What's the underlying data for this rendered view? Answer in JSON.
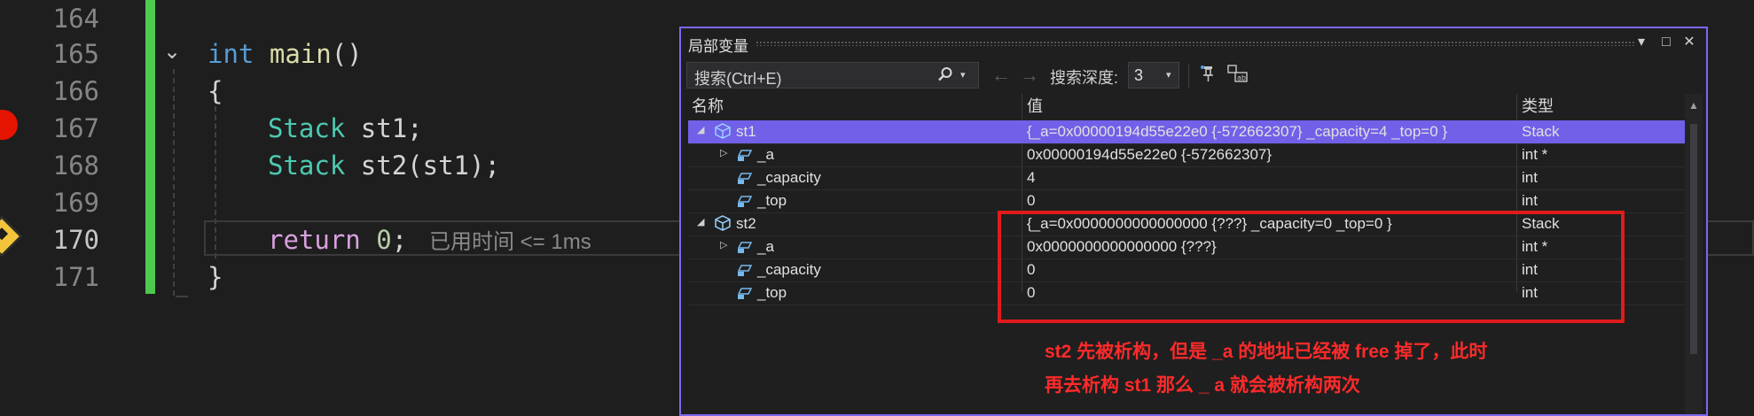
{
  "editor": {
    "lines": [
      {
        "number": "164"
      },
      {
        "number": "165",
        "tokens": {
          "keyword": "int",
          "name": "main",
          "rest": "()"
        }
      },
      {
        "number": "166",
        "text": "{"
      },
      {
        "number": "167",
        "tokens": {
          "type": "Stack",
          "rest": " st1;"
        }
      },
      {
        "number": "168",
        "tokens": {
          "type": "Stack",
          "name": "st2",
          "rest": "(st1);"
        }
      },
      {
        "number": "169"
      },
      {
        "number": "170",
        "tokens": {
          "keyword": "return",
          "value": "0",
          "rest": ";"
        }
      },
      {
        "number": "171",
        "text": "}"
      }
    ],
    "elapsed_hint": "已用时间 <= 1ms",
    "fold_icon": "chevron-down-icon",
    "colors": {
      "change_bar": "#4ec94e",
      "breakpoint": "#e51400",
      "current_statement": "#f3c53a"
    }
  },
  "locals_window": {
    "title": "局部变量",
    "title_buttons": {
      "dropdown": "▾",
      "maximize": "□",
      "close": "✕"
    },
    "search": {
      "placeholder": "搜索(Ctrl+E)",
      "icon": "search-icon",
      "caret": "▾"
    },
    "nav": {
      "back": "←",
      "forward": "→"
    },
    "depth": {
      "label": "搜索深度:",
      "value": "3",
      "caret": "▾"
    },
    "columns": {
      "name": "名称",
      "value": "值",
      "type": "类型"
    },
    "rows": [
      {
        "expander": "◢",
        "name": "st1",
        "value": "{_a=0x00000194d55e22e0 {-572662307} _capacity=4 _top=0 }",
        "type": "Stack",
        "selected": true
      },
      {
        "expander": "▷",
        "name": "_a",
        "value": "0x00000194d55e22e0 {-572662307}",
        "type": "int *"
      },
      {
        "name": "_capacity",
        "value": "4",
        "type": "int"
      },
      {
        "name": "_top",
        "value": "0",
        "type": "int"
      },
      {
        "expander": "◢",
        "name": "st2",
        "value": "{_a=0x0000000000000000 {???} _capacity=0 _top=0 }",
        "type": "Stack"
      },
      {
        "expander": "▷",
        "name": "_a",
        "value": "0x0000000000000000 {???}",
        "type": "int *"
      },
      {
        "name": "_capacity",
        "value": "0",
        "type": "int"
      },
      {
        "name": "_top",
        "value": "0",
        "type": "int"
      }
    ],
    "accent_color": "#7160e8"
  },
  "annotation": {
    "color": "#e01b1b",
    "line1": "st2 先被析构，但是 _a 的地址已经被 free 掉了，此时",
    "line2": "再去析构 st1 那么 _ a 就会被析构两次"
  }
}
